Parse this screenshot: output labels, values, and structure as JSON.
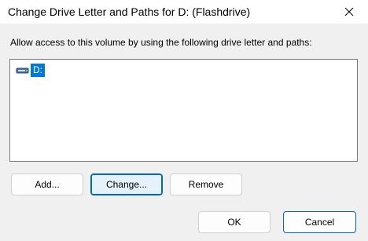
{
  "window": {
    "title": "Change Drive Letter and Paths for D: (Flashdrive)",
    "close_icon": "close-icon"
  },
  "instruction": "Allow access to this volume by using the following drive letter and paths:",
  "list": {
    "items": [
      {
        "label": "D:",
        "icon": "drive-icon",
        "selected": true
      }
    ]
  },
  "buttons": {
    "add": "Add...",
    "change": "Change...",
    "remove": "Remove",
    "ok": "OK",
    "cancel": "Cancel"
  },
  "colors": {
    "selection": "#0078d7",
    "accent_border": "#0067c0"
  }
}
